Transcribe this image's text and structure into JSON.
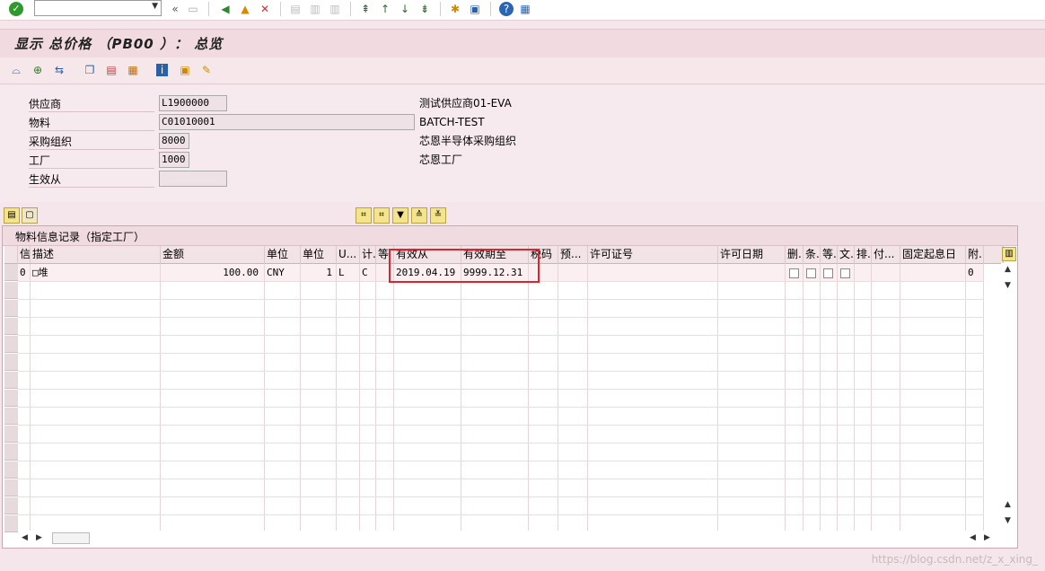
{
  "system_toolbar": {
    "command_value": "",
    "history_glyph": "«"
  },
  "title": "显示 总价格 （PB00 ）： 总览",
  "header": {
    "vendor_label": "供应商",
    "vendor_value": "L1900000",
    "vendor_desc": "测试供应商01-EVA",
    "material_label": "物料",
    "material_value": "C01010001",
    "material_desc": "BATCH-TEST",
    "purch_org_label": "采购组织",
    "purch_org_value": "8000",
    "purch_org_desc": "芯恩半导体采购组织",
    "plant_label": "工厂",
    "plant_value": "1000",
    "plant_desc": "芯恩工厂",
    "valid_from_label": "生效从",
    "valid_from_value": ""
  },
  "table": {
    "title": "物料信息记录（指定工厂）",
    "columns": [
      "信",
      "描述",
      "金额",
      "单位",
      "单位",
      "U...",
      "计.",
      "等",
      "有效从",
      "有效期至",
      "税码",
      "预...",
      "许可证号",
      "许可日期",
      "删.",
      "条.",
      "等.",
      "文.",
      "排.",
      "付...",
      "固定起息日",
      "附."
    ],
    "row": {
      "c0": "0",
      "c1": "□堆",
      "c2": "100.00",
      "c3": "CNY",
      "c4": "1",
      "c5": "L",
      "c6": "C",
      "c7": "",
      "c8": "2019.04.19",
      "c9": "9999.12.31",
      "c21": "0"
    }
  },
  "watermark": "https://blog.csdn.net/z_x_xing_"
}
